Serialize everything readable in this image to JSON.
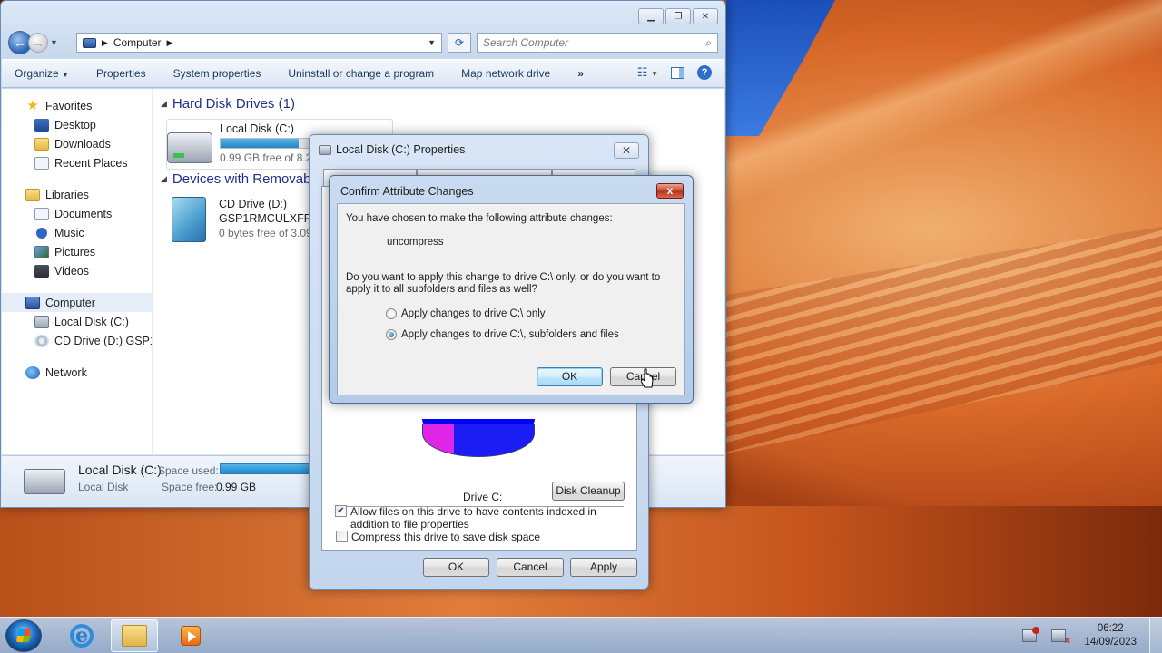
{
  "explorer": {
    "address_path": "Computer",
    "search_placeholder": "Search Computer",
    "toolbar": [
      "Organize",
      "Properties",
      "System properties",
      "Uninstall or change a program",
      "Map network drive"
    ],
    "toolbar_more": "»",
    "nav": {
      "favorites": "Favorites",
      "desktop": "Desktop",
      "downloads": "Downloads",
      "recent": "Recent Places",
      "libraries": "Libraries",
      "documents": "Documents",
      "music": "Music",
      "pictures": "Pictures",
      "videos": "Videos",
      "computer": "Computer",
      "local_disk": "Local Disk (C:)",
      "cd_drive": "CD Drive (D:) GSP1R",
      "network": "Network"
    },
    "groups": {
      "hdd_header": "Hard Disk Drives (1)",
      "removable_header": "Devices with Removab"
    },
    "drives": {
      "c_name": "Local Disk (C:)",
      "c_free": "0.99 GB free of 8.26",
      "c_fill": 0.88,
      "d_name": "CD Drive (D:)",
      "d_label": "GSP1RMCULXFRER",
      "d_free": "0 bytes free of 3.09"
    },
    "details": {
      "title": "Local Disk (C:)",
      "subtitle": "Local Disk",
      "space_used_label": "Space used:",
      "space_free_label": "Space free:",
      "space_free_value": "0.99 GB"
    }
  },
  "properties": {
    "title": "Local Disk (C:) Properties",
    "close_label": "✕",
    "drive_label": "Drive C:",
    "disk_cleanup": "Disk Cleanup",
    "compress_label": "Compress this drive to save disk space",
    "compress_checked": false,
    "index_label": "Allow files on this drive to have contents indexed in addition to file properties",
    "index_checked": true,
    "ok": "OK",
    "cancel": "Cancel",
    "apply": "Apply"
  },
  "confirm": {
    "title": "Confirm Attribute Changes",
    "close_label": "x",
    "line1": "You have chosen to make the following attribute changes:",
    "change": "uncompress",
    "question": "Do you want to apply this change to drive C:\\ only, or do you want to apply it to all subfolders and files as well?",
    "option1": "Apply changes to drive C:\\ only",
    "option2": "Apply changes to drive C:\\, subfolders and files",
    "selected_option": 2,
    "ok": "OK",
    "cancel": "Cancel"
  },
  "taskbar": {
    "time": "06:22",
    "date": "14/09/2023"
  }
}
